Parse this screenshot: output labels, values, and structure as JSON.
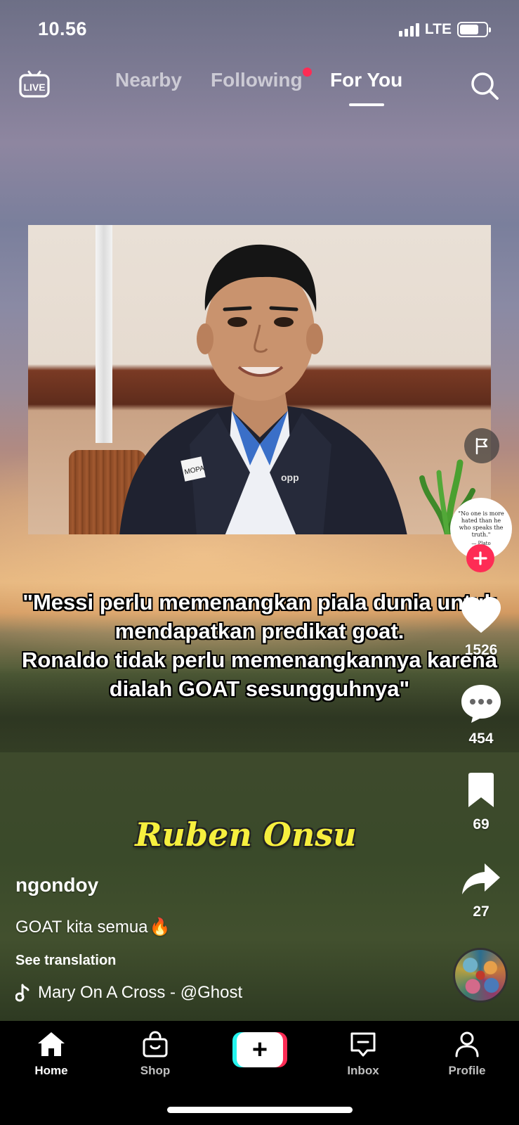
{
  "status_bar": {
    "time": "10.56",
    "network": "LTE",
    "battery_level": 0.72
  },
  "top_nav": {
    "live_label": "LIVE",
    "tabs": [
      {
        "label": "Nearby",
        "active": false
      },
      {
        "label": "Following",
        "active": false,
        "has_notification_dot": true
      },
      {
        "label": "For You",
        "active": true
      }
    ]
  },
  "video": {
    "quote_lines": [
      "\"Messi perlu memenangkan piala dunia untuk",
      "mendapatkan predikat goat.",
      "Ronaldo tidak perlu memenangkannya karena",
      "dialah GOAT sesungguhnya\""
    ],
    "name_tag": "Ruben Onsu",
    "badge_text": "MOPA",
    "lapel_text": "opp"
  },
  "creator_avatar": {
    "quote": "\"No one is more hated than he who speaks the truth.\"",
    "author": "— Plato"
  },
  "actions": {
    "likes": "1526",
    "comments": "454",
    "saves": "69",
    "shares": "27"
  },
  "post": {
    "username": "ngondoy",
    "description": "GOAT kita semua",
    "description_emoji": "🔥",
    "see_translation": "See translation",
    "music": "Mary On A Cross - @Ghost"
  },
  "bottom_nav": {
    "home": "Home",
    "shop": "Shop",
    "create": "+",
    "inbox": "Inbox",
    "profile": "Profile"
  },
  "colors": {
    "accent": "#fe2c55",
    "cyan": "#25f4ee",
    "name_tag": "#f6ef3e"
  }
}
